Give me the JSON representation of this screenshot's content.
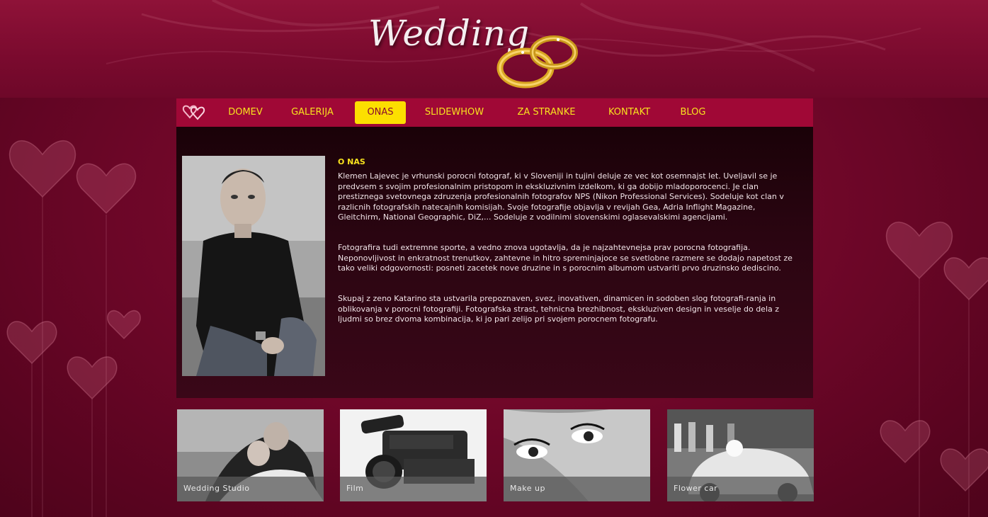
{
  "header": {
    "logo_text": "Wedding"
  },
  "nav": {
    "items": [
      {
        "label": "DOMEV"
      },
      {
        "label": "GALERIJA"
      },
      {
        "label": "ONAS"
      },
      {
        "label": "SLIDEWHOW"
      },
      {
        "label": "ZA STRANKE"
      },
      {
        "label": "KONTAKT"
      },
      {
        "label": "BLOG"
      }
    ],
    "active_label": "ONAS"
  },
  "about": {
    "title": "O NAS",
    "paragraphs": [
      "Klemen Lajevec je vrhunski porocni fotograf, ki v Sloveniji in tujini deluje ze vec kot osemnajst let. Uveljavil se je predvsem s svojim profesionalnim pristopom in ekskluzivnim izdelkom, ki ga dobijo mladoporocenci. Je clan prestiznega svetovnega zdruzenja profesionalnih fotografov NPS (Nikon Professional Services). Sodeluje kot clan v razlicnih fotografskih natecajnih komisijah. Svoje fotografije objavlja v revijah Gea, Adria Inflight Magazine, Gleitchirm, National Geographic, DiZ,... Sodeluje z vodilnimi slovenskimi oglasevalskimi agencijami.",
      "Fotografira tudi extremne sporte, a vedno znova ugotavlja, da je najzahtevnejsa prav porocna fotografija. Neponovljivost in enkratnost trenutkov, zahtevne in hitro spreminjajoce se svetlobne razmere se dodajo napetost ze tako veliki odgovornosti: posneti zacetek nove druzine in s porocnim albumom ustvariti prvo druzinsko dediscino.",
      "Skupaj z zeno Katarino sta ustvarila prepoznaven, svez, inovativen, dinamicen in sodoben slog fotografi-ranja in oblikovanja v porocni fotografiji. Fotografska strast, tehnicna brezhibnost, ekskluziven design in veselje do dela z ljudmi so brez dvoma kombinacija, ki jo pari zelijo pri svojem porocnem fotografu."
    ]
  },
  "thumbnails": [
    {
      "caption": "Wedding Studio"
    },
    {
      "caption": "Film"
    },
    {
      "caption": "Make up"
    },
    {
      "caption": "Flower car"
    }
  ],
  "colors": {
    "nav_bg": "#a00836",
    "nav_text": "#f8e21e",
    "active_bg": "#fcdf00",
    "page_bg": "#6b0627"
  }
}
